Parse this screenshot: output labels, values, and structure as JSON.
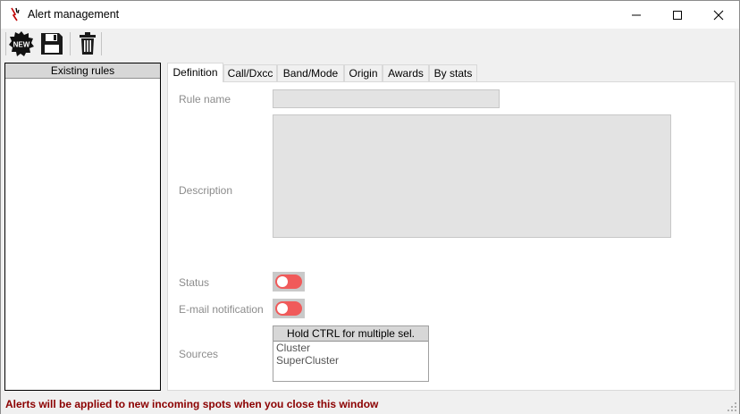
{
  "window": {
    "title": "Alert management",
    "controls": {
      "minimize": "minimize-icon",
      "maximize": "maximize-icon",
      "close": "close-icon"
    }
  },
  "toolbar": {
    "new_badge": "NEW",
    "buttons": [
      "new-rule-icon",
      "save-icon",
      "trash-icon"
    ]
  },
  "rules_panel": {
    "header": "Existing rules",
    "items": []
  },
  "tabs": [
    "Definition",
    "Call/Dxcc",
    "Band/Mode",
    "Origin",
    "Awards",
    "By stats"
  ],
  "active_tab": "Definition",
  "definition": {
    "rule_name_label": "Rule name",
    "rule_name_value": "",
    "description_label": "Description",
    "description_value": "",
    "status_label": "Status",
    "status_enabled": false,
    "email_label": "E-mail notification",
    "email_enabled": false,
    "sources_label": "Sources",
    "sources_header": "Hold CTRL for multiple sel.",
    "sources_items": [
      "Cluster",
      "SuperCluster"
    ]
  },
  "status_bar": {
    "message": "Alerts will be applied to new incoming spots when you close this window",
    "color": "#8b0000"
  },
  "colors": {
    "toggle_off": "#f05a5a",
    "disabled_input": "#e3e3e3",
    "header_gray": "#d7d7d7"
  }
}
